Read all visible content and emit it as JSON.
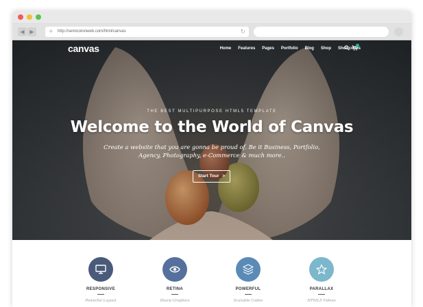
{
  "browser": {
    "url": "http://semicolonweb.com/html/canvas"
  },
  "site": {
    "logo": "canvas",
    "menu": [
      "Home",
      "Features",
      "Pages",
      "Portfolio",
      "Blog",
      "Shop",
      "Shortcodes"
    ]
  },
  "hero": {
    "eyebrow": "THE BEST MULTIPURPOSE HTML5 TEMPLATE",
    "headline": "Welcome to the World of Canvas",
    "subtext_line1": "Create a website that you are gonna be proud of. Be it Business, Portfolio,",
    "subtext_line2": "Agency, Photography, e-Commerce & much more..",
    "cta_label": "Start Tour",
    "cta_arrow": ">"
  },
  "features": [
    {
      "title": "RESPONSIVE",
      "subtitle": "Powerful Layout",
      "icon": "monitor-icon",
      "color": "#4a5a7a"
    },
    {
      "title": "RETINA",
      "subtitle": "Sharp Graphics",
      "icon": "eye-icon",
      "color": "#55709c"
    },
    {
      "title": "POWERFUL",
      "subtitle": "Scalable Codes",
      "icon": "layers-icon",
      "color": "#5b8ab6"
    },
    {
      "title": "PARALLAX",
      "subtitle": "HTML5 Videos",
      "icon": "star-icon",
      "color": "#7cb7cc"
    }
  ],
  "colors": {
    "accent": "#1abc9c",
    "window_red": "#ee5d57",
    "window_yellow": "#f3be3c",
    "window_green": "#5cc44f"
  }
}
